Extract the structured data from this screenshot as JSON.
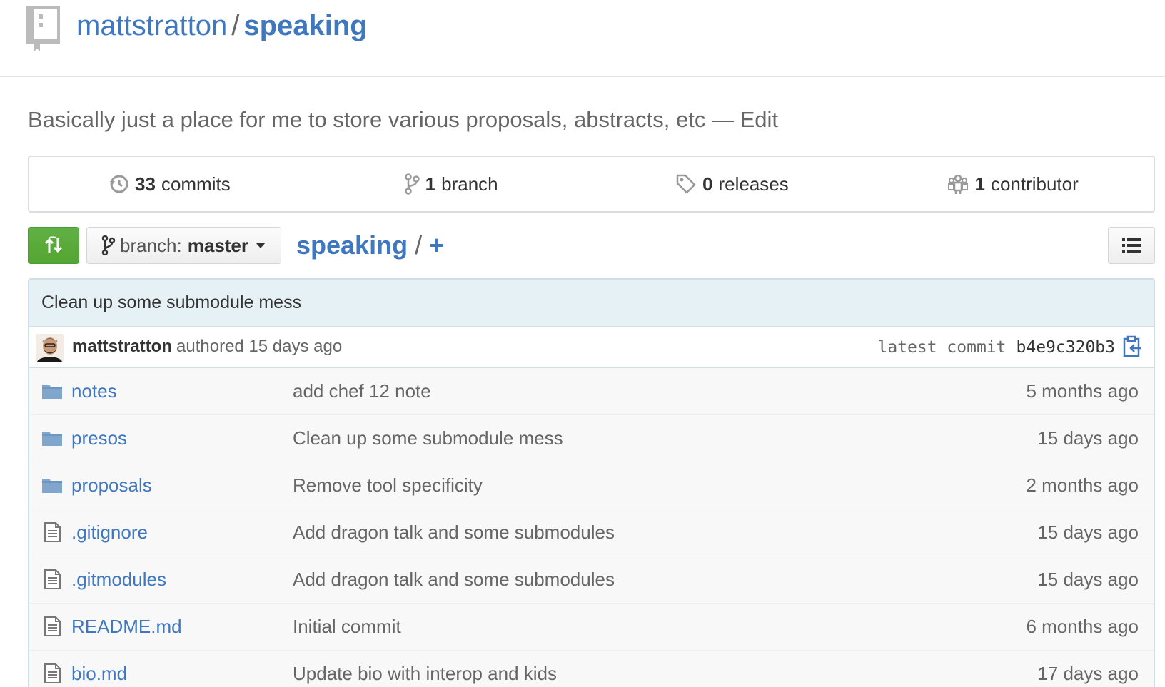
{
  "repo": {
    "owner": "mattstratton",
    "separator": "/",
    "name": "speaking",
    "description": "Basically just a place for me to store various proposals, abstracts, etc",
    "description_dash": "—",
    "edit_label": "Edit"
  },
  "stats": {
    "commits": {
      "count": "33",
      "label": "commits",
      "icon": "history-icon"
    },
    "branches": {
      "count": "1",
      "label": "branch",
      "icon": "git-branch-icon"
    },
    "releases": {
      "count": "0",
      "label": "releases",
      "icon": "tag-icon"
    },
    "contributors": {
      "count": "1",
      "label": "contributor",
      "icon": "organization-icon"
    }
  },
  "toolbar": {
    "compare_icon": "compare-icon",
    "branch_prefix": "branch:",
    "branch_name": "master",
    "path_root": "speaking",
    "path_sep": "/",
    "path_add": "+",
    "list_icon": "list-icon"
  },
  "latest_commit": {
    "message": "Clean up some submodule mess",
    "author": "mattstratton",
    "authored": "authored 15 days ago",
    "label": "latest commit",
    "sha": "b4e9c320b3"
  },
  "files": [
    {
      "type": "folder",
      "name": "notes",
      "message": "add chef 12 note",
      "age": "5 months ago"
    },
    {
      "type": "folder",
      "name": "presos",
      "message": "Clean up some submodule mess",
      "age": "15 days ago"
    },
    {
      "type": "folder",
      "name": "proposals",
      "message": "Remove tool specificity",
      "age": "2 months ago"
    },
    {
      "type": "file",
      "name": ".gitignore",
      "message": "Add dragon talk and some submodules",
      "age": "15 days ago"
    },
    {
      "type": "file",
      "name": ".gitmodules",
      "message": "Add dragon talk and some submodules",
      "age": "15 days ago"
    },
    {
      "type": "file",
      "name": "README.md",
      "message": "Initial commit",
      "age": "6 months ago"
    },
    {
      "type": "file",
      "name": "bio.md",
      "message": "Update bio with interop and kids",
      "age": "17 days ago"
    }
  ],
  "colors": {
    "link": "#4078c0",
    "compare_green": "#55a532",
    "commit_bar": "#e6f1f6",
    "folder": "#80a6cd"
  }
}
